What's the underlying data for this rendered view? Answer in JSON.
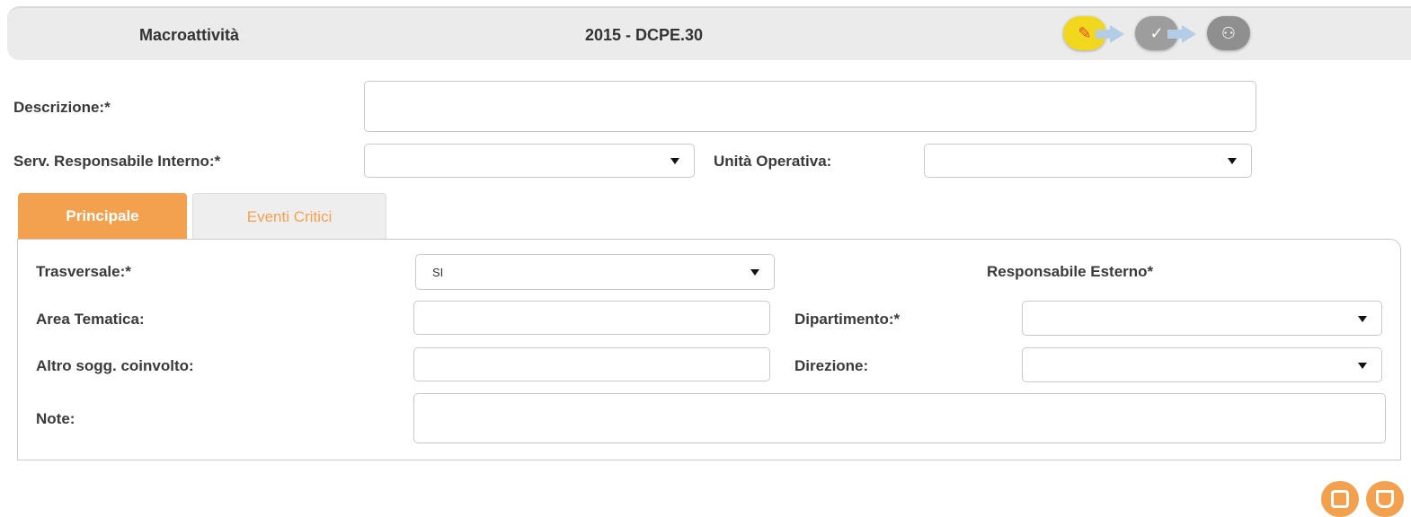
{
  "header": {
    "title": "Macroattività",
    "code": "2015 - DCPE.30",
    "steps": [
      {
        "icon": "pencil-icon",
        "glyph": "✎",
        "state": "active"
      },
      {
        "icon": "check-icon",
        "glyph": "✓",
        "state": "inactive"
      },
      {
        "icon": "users-icon",
        "glyph": "⚇",
        "state": "inactive"
      }
    ]
  },
  "form": {
    "descrizione_label": "Descrizione:*",
    "descrizione_value": "",
    "serv_resp_label": "Serv. Responsabile Interno:*",
    "serv_resp_value": "",
    "unita_label": "Unità Operativa:",
    "unita_value": ""
  },
  "tabs": {
    "principale": "Principale",
    "eventi": "Eventi Critici"
  },
  "panel": {
    "trasversale_label": "Trasversale:*",
    "trasversale_value": "SI",
    "resp_esterno_label": "Responsabile Esterno*",
    "area_label": "Area Tematica:",
    "area_value": "",
    "dipartimento_label": "Dipartimento:*",
    "dipartimento_value": "",
    "altro_label": "Altro sogg. coinvolto:",
    "altro_value": "",
    "direzione_label": "Direzione:",
    "direzione_value": "",
    "note_label": "Note:",
    "note_value": ""
  },
  "actions": {
    "save_icon": "save-icon",
    "delete_icon": "trash-icon"
  },
  "colors": {
    "accent": "#f4a14f",
    "header_bg": "#ebebeb",
    "step_active": "#f1d81e",
    "step_inactive": "#9d9d9d"
  }
}
